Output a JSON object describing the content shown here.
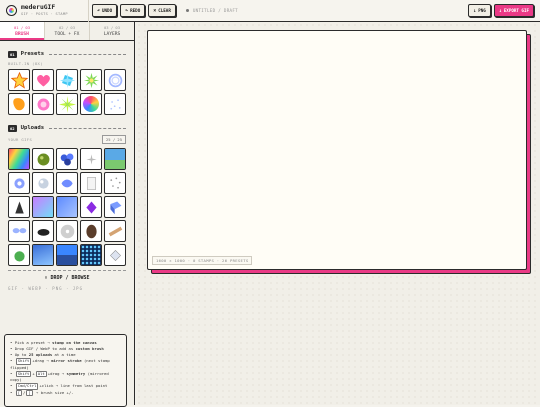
{
  "app": {
    "name": "mederuGIF",
    "subtitle": "GIF · POSTS · STAMP"
  },
  "toolbar": {
    "undo": "UNDO",
    "redo": "REDO",
    "clear": "CLEAR",
    "status": "UNTITLED / DRAFT",
    "png": "PNG",
    "export": "EXPORT GIF"
  },
  "tabs": [
    {
      "num": "01 / 03",
      "label": "BRUSH"
    },
    {
      "num": "02 / 03",
      "label": "TOOL + FX"
    },
    {
      "num": "03 / 03",
      "label": "LAYERS"
    }
  ],
  "presets": {
    "badge": "01",
    "title": "Presets",
    "sub": "BUILT-IN (8X)"
  },
  "uploads": {
    "badge": "02",
    "title": "Uploads",
    "sub": "YOUR GIFS",
    "count": "25 / 25"
  },
  "drop": {
    "label": "DROP / BROWSE",
    "formats": "GIF · WEBP · PNG · JPG"
  },
  "hints": {
    "l1a": "Pick a preset → ",
    "l1b": "stamp on the canvas",
    "l2a": "Drop GIF / WebP to add as ",
    "l2b": "custom brush",
    "l3a": "Up to ",
    "l3b": "25 uploads",
    "l3c": " at a time",
    "k_shift": "Shift",
    "l4a": "+drag → ",
    "l4b": "mirror stroke",
    "l4c": " (next stamp flipped)",
    "k_shift2": "Shift",
    "k_alt": "Alt",
    "l5a": "+drag → ",
    "l5b": "symmetry",
    "l5c": " (mirrored copy)",
    "k_ctrl": "Cmd/Ctrl",
    "l6a": "+click → line from last point",
    "k_lb": "[",
    "k_rb": "]",
    "l7a": " → brush size +/-"
  },
  "canvas": {
    "info": "1600 × 1000 · 0 STAMPS · 26 PRESETS"
  },
  "colors": {
    "accent": "#ea3a86",
    "ink": "#2b2b2b",
    "paper": "#fffdf6"
  }
}
